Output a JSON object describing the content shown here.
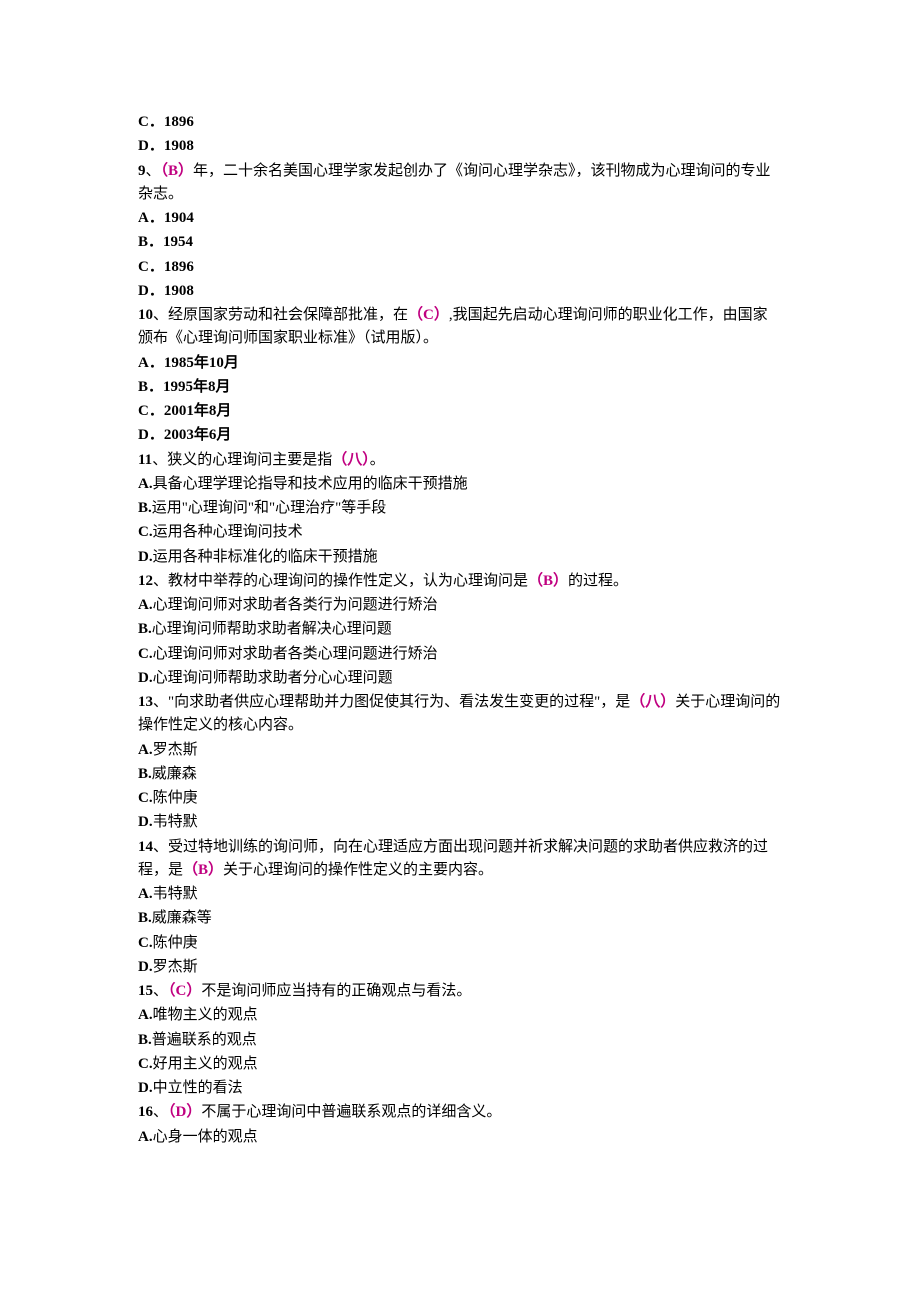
{
  "tail_opts": {
    "c": "C．1896",
    "d": "D．1908"
  },
  "q9": {
    "num": "9",
    "pre": "、",
    "ans": "（B）",
    "post": "年，二十余名美国心理学家发起创办了《询问心理学杂志》，该刊物成为心理询问的专业杂志。",
    "a": "A．1904",
    "b": "B．1954",
    "c": "C．1896",
    "d": "D．1908"
  },
  "q10": {
    "num": "10",
    "pre": "、经原国家劳动和社会保障部批准，在",
    "ans": "（C）",
    "post": ",我国起先启动心理询问师的职业化工作，由国家颁布《心理询问师国家职业标准》（试用版）。",
    "a": "A．1985年10月",
    "b": "B．1995年8月",
    "c": "C．2001年8月",
    "d": "D．2003年6月"
  },
  "q11": {
    "num": "11",
    "pre": "、狭义的心理询问主要是指",
    "ans": "（八）",
    "post": "。",
    "a_label": "A.",
    "a_text": "具备心理学理论指导和技术应用的临床干预措施",
    "b_label": "B.",
    "b_text": "运用\"心理询问\"和\"心理治疗\"等手段",
    "c_label": "C.",
    "c_text": "运用各种心理询问技术",
    "d_label": "D.",
    "d_text": "运用各种非标准化的临床干预措施"
  },
  "q12": {
    "num": "12",
    "pre": "、教材中举荐的心理询问的操作性定义，认为心理询问是",
    "ans": "（B）",
    "post": "的过程。",
    "a_label": "A.",
    "a_text": "心理询问师对求助者各类行为问题进行矫治",
    "b_label": "B.",
    "b_text": "心理询问师帮助求助者解决心理问题",
    "c_label": "C.",
    "c_text": "心理询问师对求助者各类心理问题进行矫治",
    "d_label": "D.",
    "d_text": "心理询问师帮助求助者分心心理问题"
  },
  "q13": {
    "num": "13",
    "pre": "、\"向求助者供应心理帮助并力图促使其行为、看法发生变更的过程\"，是",
    "ans": "（八）",
    "post": "关于心理询问的操作性定义的核心内容。",
    "a_label": "A.",
    "a_text": "罗杰斯",
    "b_label": "B.",
    "b_text": "威廉森",
    "c_label": "C.",
    "c_text": "陈仲庚",
    "d_label": "D.",
    "d_text": "韦特默"
  },
  "q14": {
    "num": "14",
    "pre": "、受过特地训练的询问师，向在心理适应方面出现问题并祈求解决问题的求助者供应救济的过程，是",
    "ans": "（B）",
    "post": "关于心理询问的操作性定义的主要内容。",
    "a_label": "A.",
    "a_text": "韦特默",
    "b_label": "B.",
    "b_text": "威廉森等",
    "c_label": "C.",
    "c_text": "陈仲庚",
    "d_label": "D.",
    "d_text": "罗杰斯"
  },
  "q15": {
    "num": "15",
    "pre": "、",
    "ans": "（C）",
    "post": "不是询问师应当持有的正确观点与看法。",
    "a_label": "A.",
    "a_text": "唯物主义的观点",
    "b_label": "B.",
    "b_text": "普遍联系的观点",
    "c_label": "C.",
    "c_text": "好用主义的观点",
    "d_label": "D.",
    "d_text": "中立性的看法"
  },
  "q16": {
    "num": "16",
    "pre": "、",
    "ans": "（D）",
    "post": "不属于心理询问中普遍联系观点的详细含义。",
    "a_label": "A.",
    "a_text": "心身一体的观点"
  }
}
